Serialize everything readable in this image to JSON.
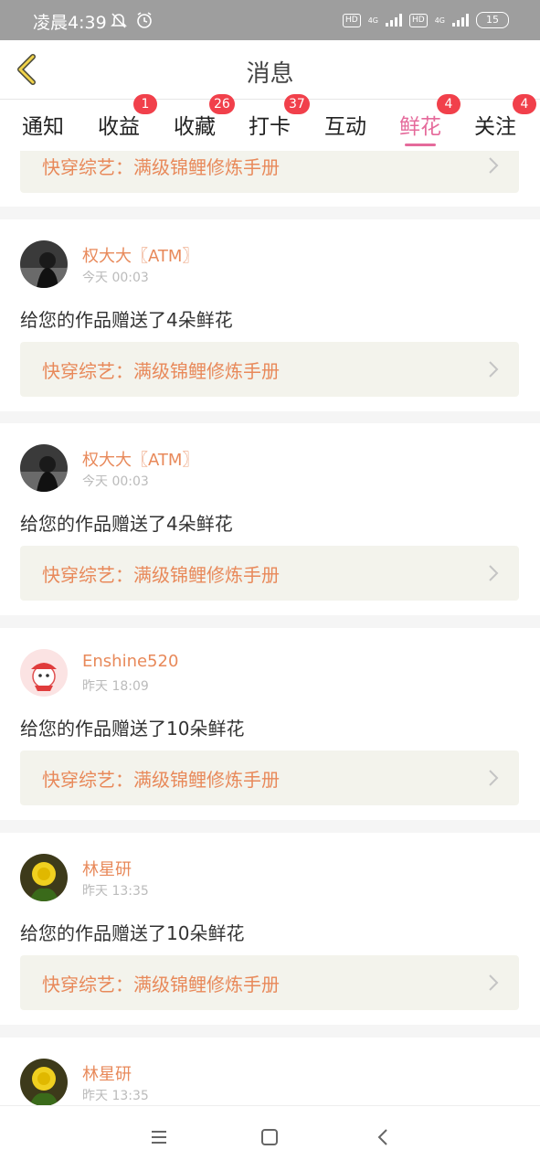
{
  "status": {
    "time": "凌晨4:39",
    "hd1": "HD",
    "sig1": "4G",
    "hd2": "HD",
    "sig2": "4G",
    "battery": "15"
  },
  "header": {
    "title": "消息"
  },
  "tabs": [
    {
      "label": "通知",
      "badge": ""
    },
    {
      "label": "收益",
      "badge": "1"
    },
    {
      "label": "收藏",
      "badge": "26"
    },
    {
      "label": "打卡",
      "badge": "37"
    },
    {
      "label": "互动",
      "badge": ""
    },
    {
      "label": "鲜花",
      "badge": "4"
    },
    {
      "label": "关注",
      "badge": "4"
    }
  ],
  "active_tab": "鲜花",
  "top_partial": {
    "book": "快穿综艺：满级锦鲤修炼手册"
  },
  "items": [
    {
      "user": "权大大〖ATM〗",
      "time": "今天 00:03",
      "message": "给您的作品赠送了4朵鲜花",
      "book": "快穿综艺：满级锦鲤修炼手册",
      "avatar": "dark-photo-avatar"
    },
    {
      "user": "权大大〖ATM〗",
      "time": "今天 00:03",
      "message": "给您的作品赠送了4朵鲜花",
      "book": "快穿综艺：满级锦鲤修炼手册",
      "avatar": "dark-photo-avatar"
    },
    {
      "user": "Enshine520",
      "time": "昨天 18:09",
      "message": "给您的作品赠送了10朵鲜花",
      "book": "快穿综艺：满级锦鲤修炼手册",
      "avatar": "cartoon-avatar"
    },
    {
      "user": "林星研",
      "time": "昨天 13:35",
      "message": "给您的作品赠送了10朵鲜花",
      "book": "快穿综艺：满级锦鲤修炼手册",
      "avatar": "flower-avatar"
    },
    {
      "user": "林星研",
      "time": "昨天 13:35",
      "avatar": "flower-avatar"
    }
  ],
  "colors": {
    "accent": "#e56a9b",
    "badge": "#f1404b",
    "link_text": "#e8895a",
    "link_bg": "#f3f3ec"
  }
}
